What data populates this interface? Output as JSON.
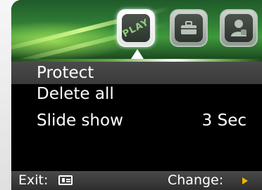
{
  "header": {
    "modes": [
      {
        "icon": "play-mode-icon",
        "label": "PLAY",
        "active": true
      },
      {
        "icon": "toolbox-mode-icon",
        "active": false
      },
      {
        "icon": "person-setup-mode-icon",
        "active": false
      }
    ]
  },
  "menu": {
    "items": [
      {
        "label": "Protect",
        "value": "",
        "selected": true
      },
      {
        "label": "Delete all",
        "value": "",
        "selected": false
      },
      {
        "label": "Slide show",
        "value": "3 Sec",
        "selected": false
      }
    ]
  },
  "footer": {
    "exit_label": "Exit:",
    "exit_key_icon": "menu-key-icon",
    "change_label": "Change:",
    "change_key_icon": "right-arrow-icon"
  },
  "colors": {
    "header_green": "#2f7a34",
    "selection_bar": "#3a3a3a",
    "arrow_accent": "#f4b400",
    "text": "#ffffff"
  }
}
